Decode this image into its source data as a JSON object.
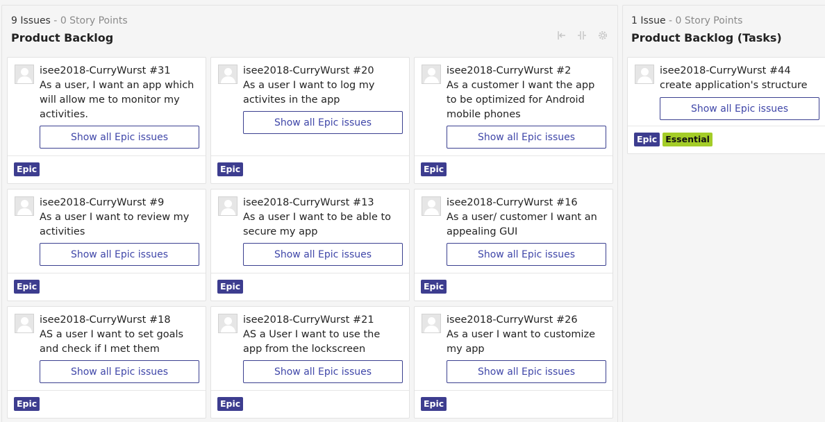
{
  "columns": [
    {
      "issues_label": "9 Issues",
      "separator": " - ",
      "points_label": "0 Story Points",
      "title": "Product Backlog",
      "header_icons": [
        "collapse-icon",
        "split-icon",
        "settings-icon"
      ]
    },
    {
      "issues_label": "1 Issue",
      "separator": " - ",
      "points_label": "0 Story Points",
      "title": "Product Backlog (Tasks)"
    }
  ],
  "cards": [
    {
      "project": "isee2018-CurryWurst",
      "number": "#31",
      "summary": "As a user, I want an app which will allow me to monitor my activities.",
      "button": "Show all Epic issues",
      "labels": [
        "Epic"
      ]
    },
    {
      "project": "isee2018-CurryWurst",
      "number": "#20",
      "summary": "As a user I want to log my activites in the app",
      "button": "Show all Epic issues",
      "labels": [
        "Epic"
      ]
    },
    {
      "project": "isee2018-CurryWurst",
      "number": "#2",
      "summary": "As a customer I want the app to be optimized for Android mobile phones",
      "button": "Show all Epic issues",
      "labels": [
        "Epic"
      ]
    },
    {
      "project": "isee2018-CurryWurst",
      "number": "#9",
      "summary": "As a user I want to review my activities",
      "button": "Show all Epic issues",
      "labels": [
        "Epic"
      ]
    },
    {
      "project": "isee2018-CurryWurst",
      "number": "#13",
      "summary": "As a user I want to be able to secure my app",
      "button": "Show all Epic issues",
      "labels": [
        "Epic"
      ]
    },
    {
      "project": "isee2018-CurryWurst",
      "number": "#16",
      "summary": "As a user/ customer I want an appealing GUI",
      "button": "Show all Epic issues",
      "labels": [
        "Epic"
      ]
    },
    {
      "project": "isee2018-CurryWurst",
      "number": "#18",
      "summary": "AS a user I want to set goals and check if I met them",
      "button": "Show all Epic issues",
      "labels": [
        "Epic"
      ]
    },
    {
      "project": "isee2018-CurryWurst",
      "number": "#21",
      "summary": "AS a User I want to use the app from the lockscreen",
      "button": "Show all Epic issues",
      "labels": [
        "Epic"
      ]
    },
    {
      "project": "isee2018-CurryWurst",
      "number": "#26",
      "summary": "As a user I want to customize my app",
      "button": "Show all Epic issues",
      "labels": [
        "Epic"
      ]
    },
    {
      "project": "isee2018-CurryWurst",
      "number": "#44",
      "summary": "create application's structure",
      "button": "Show all Epic issues",
      "labels": [
        "Epic",
        "Essential"
      ]
    }
  ]
}
